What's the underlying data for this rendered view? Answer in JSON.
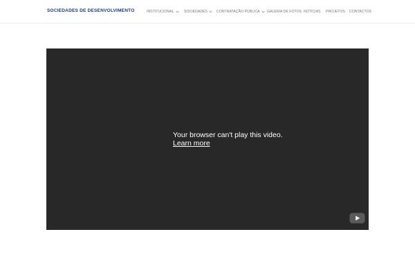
{
  "header": {
    "logo_text": "SOCIEDADES DE DESENVOLVIMENTO"
  },
  "nav": {
    "items": [
      {
        "label": "INSTITUCIONAL",
        "has_dropdown": true
      },
      {
        "label": "SOCIEDADES",
        "has_dropdown": true
      },
      {
        "label": "CONTRATAÇÃO PÚBLICA",
        "has_dropdown": true
      },
      {
        "label": "GALERIA DE FOTOS",
        "has_dropdown": false
      },
      {
        "label": "NOTÍCIAS",
        "has_dropdown": false
      },
      {
        "label": "PROJETOS",
        "has_dropdown": false
      },
      {
        "label": "CONTACTOS",
        "has_dropdown": false
      }
    ]
  },
  "video": {
    "message": "Your browser can't play this video.",
    "link_label": "Learn more"
  },
  "colors": {
    "logo": "#1d3a73",
    "nav_text": "#777777",
    "video_bg": "#282828",
    "youtube_button": "#5a5a5a"
  },
  "icons": {
    "dropdown": "chevron-down-icon",
    "player": "youtube-logo-icon"
  }
}
